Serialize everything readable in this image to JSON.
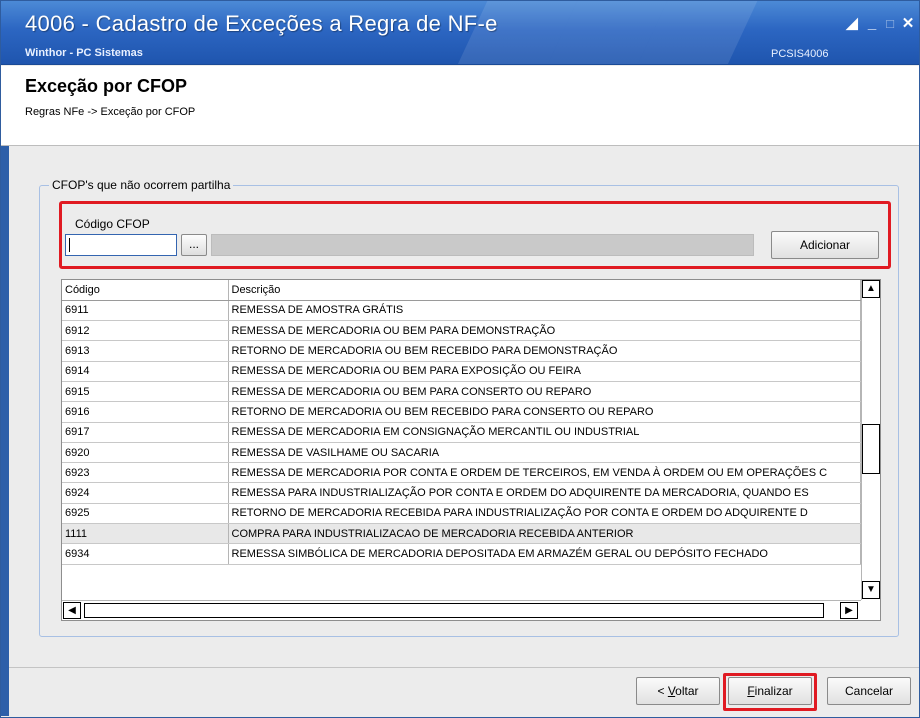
{
  "window": {
    "title": "4006 - Cadastro de Exceções a Regra de NF-e",
    "company": "Winthor - PC Sistemas",
    "routine_code": "PCSIS4006"
  },
  "header": {
    "title": "Exceção por CFOP",
    "breadcrumb": "Regras NFe -> Exceção por CFOP"
  },
  "group": {
    "legend": "CFOP's que não ocorrem partilha",
    "cfop_label": "Código CFOP",
    "cfop_value": "",
    "lookup_label": "...",
    "add_label": "Adicionar"
  },
  "grid": {
    "columns": [
      "Código",
      "Descrição"
    ],
    "rows": [
      {
        "code": "6911",
        "desc": "REMESSA DE AMOSTRA GRÁTIS"
      },
      {
        "code": "6912",
        "desc": "REMESSA DE MERCADORIA OU BEM PARA DEMONSTRAÇÃO"
      },
      {
        "code": "6913",
        "desc": "RETORNO DE MERCADORIA OU BEM RECEBIDO PARA DEMONSTRAÇÃO"
      },
      {
        "code": "6914",
        "desc": "REMESSA DE MERCADORIA OU BEM PARA EXPOSIÇÃO OU FEIRA"
      },
      {
        "code": "6915",
        "desc": "REMESSA DE MERCADORIA OU BEM PARA CONSERTO OU REPARO"
      },
      {
        "code": "6916",
        "desc": "RETORNO DE MERCADORIA OU BEM RECEBIDO PARA CONSERTO OU REPARO"
      },
      {
        "code": "6917",
        "desc": "REMESSA DE MERCADORIA EM CONSIGNAÇÃO MERCANTIL OU INDUSTRIAL"
      },
      {
        "code": "6920",
        "desc": "REMESSA DE VASILHAME OU SACARIA"
      },
      {
        "code": "6923",
        "desc": "REMESSA DE MERCADORIA POR CONTA E ORDEM DE TERCEIROS, EM VENDA À ORDEM OU EM OPERAÇÕES C"
      },
      {
        "code": "6924",
        "desc": "REMESSA PARA INDUSTRIALIZAÇÃO POR CONTA E ORDEM DO ADQUIRENTE DA MERCADORIA, QUANDO ES"
      },
      {
        "code": "6925",
        "desc": "RETORNO DE MERCADORIA RECEBIDA PARA INDUSTRIALIZAÇÃO POR CONTA E ORDEM DO ADQUIRENTE D"
      },
      {
        "code": "1111",
        "desc": "COMPRA PARA INDUSTRIALIZACAO DE MERCADORIA RECEBIDA ANTERIOR"
      },
      {
        "code": "6934",
        "desc": "REMESSA SIMBÓLICA DE MERCADORIA DEPOSITADA EM ARMAZÉM GERAL OU DEPÓSITO FECHADO"
      }
    ],
    "selected_row": 11
  },
  "footer": {
    "back_label": "< Voltar",
    "finish_label": "Finalizar",
    "cancel_label": "Cancelar"
  },
  "colors": {
    "titlebar": "#2c66c2",
    "highlight": "#e01a22",
    "group_border": "#a8c0e4"
  },
  "icons": [
    "minimize-icon",
    "maximize-icon",
    "close-icon",
    "restore-icon",
    "scroll-up-icon",
    "scroll-down-icon",
    "scroll-left-icon",
    "scroll-right-icon"
  ]
}
